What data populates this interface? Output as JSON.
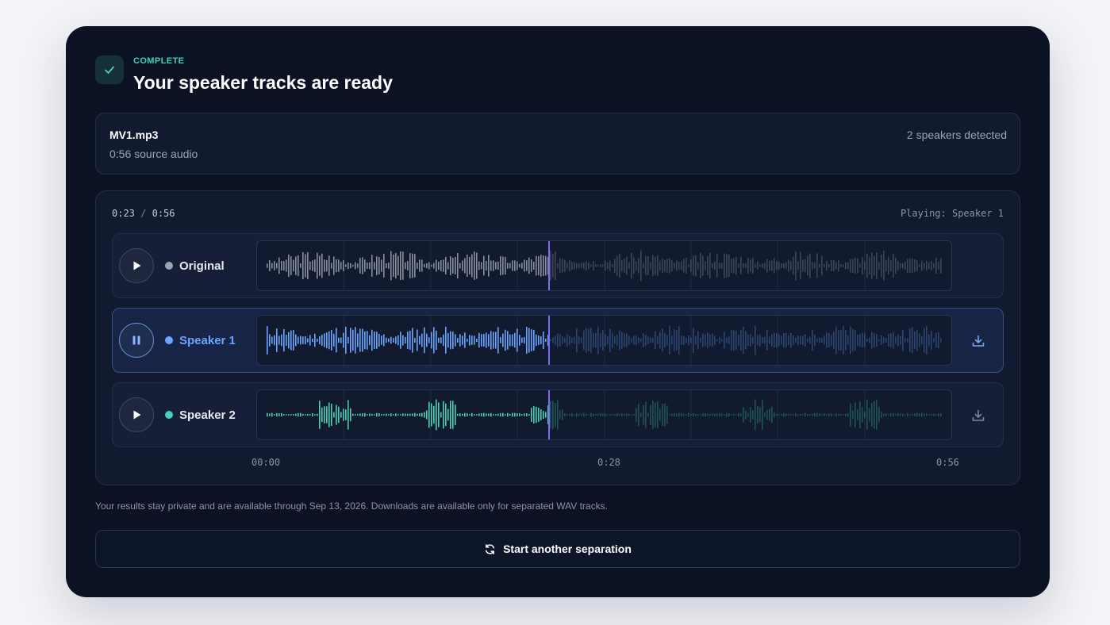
{
  "header": {
    "status": "COMPLETE",
    "title": "Your speaker tracks are ready",
    "icon": "check-icon",
    "accent": "#3fd3b8"
  },
  "file": {
    "name": "MV1.mp3",
    "duration_label": "0:56 source audio",
    "speakers_label": "2 speakers detected"
  },
  "player": {
    "current_time": "0:23",
    "time_separator": "/",
    "total_time": "0:56",
    "playing_status": "Playing: Speaker 1",
    "progress_fraction": 0.41,
    "axis_labels": [
      "00:00",
      "0:28",
      "0:56"
    ],
    "tracks": [
      {
        "name": "Original",
        "color": "#9ca3af",
        "state": "paused",
        "downloadable": false,
        "seed": 3
      },
      {
        "name": "Speaker 1",
        "color": "#6aa6ff",
        "state": "playing",
        "downloadable": true,
        "seed": 11
      },
      {
        "name": "Speaker 2",
        "color": "#45d1b6",
        "state": "paused",
        "downloadable": true,
        "seed": 29
      }
    ],
    "playhead_color": "#7b6cf0"
  },
  "footer": {
    "privacy_note": "Your results stay private and are available through Sep 13, 2026. Downloads are available only for separated WAV tracks.",
    "restart_label": "Start another separation",
    "restart_icon": "refresh-icon"
  }
}
